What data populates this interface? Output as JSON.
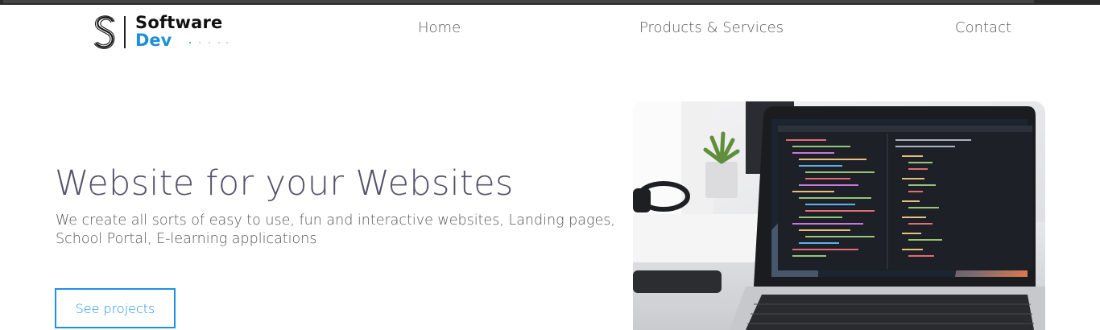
{
  "brand": {
    "line1": "Software",
    "line2": "Dev",
    "accent_color": "#1e90d6"
  },
  "nav": {
    "items": [
      {
        "label": "Home"
      },
      {
        "label": "Products & Services"
      },
      {
        "label": "Contact"
      }
    ]
  },
  "hero": {
    "title": "Website for your Websites",
    "subtitle": "We create all sorts of easy to use, fun and interactive websites, Landing pages, School Portal, E-learning applications",
    "cta_label": "See projects",
    "cta_color": "#1e8fe6",
    "image_icon": "laptop-code-photo"
  }
}
